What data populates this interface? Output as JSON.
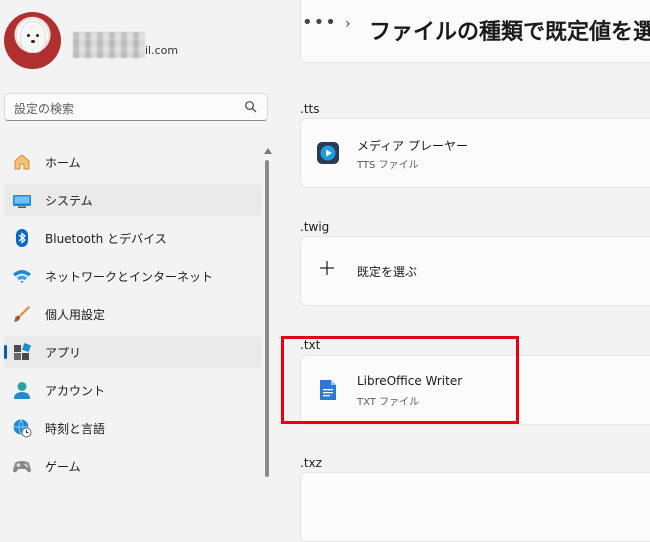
{
  "account": {
    "email_suffix": "il.com"
  },
  "search": {
    "placeholder": "設定の検索"
  },
  "nav": [
    {
      "label": "ホーム",
      "icon": "home-icon"
    },
    {
      "label": "システム",
      "icon": "system-icon"
    },
    {
      "label": "Bluetooth とデバイス",
      "icon": "bluetooth-icon"
    },
    {
      "label": "ネットワークとインターネット",
      "icon": "wifi-icon"
    },
    {
      "label": "個人用設定",
      "icon": "brush-icon"
    },
    {
      "label": "アプリ",
      "icon": "apps-icon",
      "selected": true
    },
    {
      "label": "アカウント",
      "icon": "account-icon"
    },
    {
      "label": "時刻と言語",
      "icon": "globe-clock-icon"
    },
    {
      "label": "ゲーム",
      "icon": "gamepad-icon"
    }
  ],
  "header": {
    "dots": "•••",
    "chevron": "›",
    "title": "ファイルの種類で既定値を選"
  },
  "sections": [
    {
      "ext": ".tts",
      "app": "メディア プレーヤー",
      "sub": "TTS ファイル",
      "icon": "media-player-icon"
    },
    {
      "ext": ".twig",
      "action": "既定を選ぶ",
      "icon": "plus-icon"
    },
    {
      "ext": ".txt",
      "app": "LibreOffice Writer",
      "sub": "TXT ファイル",
      "icon": "libreoffice-writer-icon"
    },
    {
      "ext": ".txz"
    }
  ],
  "colors": {
    "accent": "#005fb8",
    "highlight": "#e60012",
    "background": "#f3f3f3",
    "card": "#fbfbfb"
  }
}
